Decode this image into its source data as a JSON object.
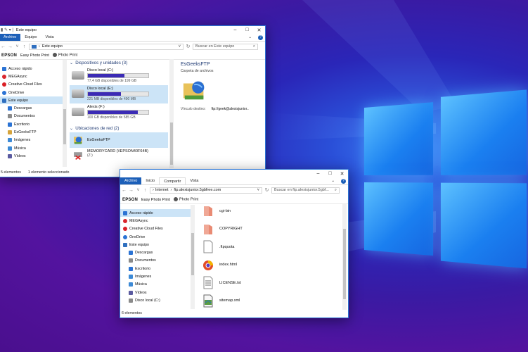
{
  "colors": {
    "accent": "#1c5fb8",
    "selection": "#cce4f7",
    "bar_fill": "#3b2bb5"
  },
  "back": {
    "title": "Este equipo",
    "tabs": [
      "Archivo",
      "Equipo",
      "Vista"
    ],
    "address": "Este equipo",
    "search_placeholder": "Buscar en Este equipo",
    "bookmarks": {
      "brand": "EPSON",
      "item1": "Easy Photo Print",
      "item2": "Photo Print"
    },
    "nav": [
      {
        "label": "Acceso rápido",
        "icon": "star-icon"
      },
      {
        "label": "MEGAsync",
        "icon": "mega-icon"
      },
      {
        "label": "Creative Cloud Files",
        "icon": "creative-cloud-icon"
      },
      {
        "label": "OneDrive",
        "icon": "cloud-icon"
      },
      {
        "label": "Este equipo",
        "icon": "computer-icon"
      },
      {
        "label": "Descargas",
        "icon": "download-icon"
      },
      {
        "label": "Documentos",
        "icon": "document-icon"
      },
      {
        "label": "Escritorio",
        "icon": "desktop-icon"
      },
      {
        "label": "EsGeeksFTP",
        "icon": "network-folder-icon"
      },
      {
        "label": "Imágenes",
        "icon": "image-icon"
      },
      {
        "label": "Música",
        "icon": "music-icon"
      },
      {
        "label": "Vídeos",
        "icon": "video-icon"
      }
    ],
    "group_devices": "Dispositivos y unidades (3)",
    "drives": [
      {
        "name": "Disco local (C:)",
        "free": "77,4 GB disponibles de 199 GB",
        "used_fraction": 0.61
      },
      {
        "name": "Disco local (E:)",
        "free": "221 MB disponibles de 490 MB",
        "used_fraction": 0.55
      },
      {
        "name": "Alexis (F:)",
        "free": "100 GB disponibles de 585 GB",
        "used_fraction": 0.83
      }
    ],
    "group_network": "Ubicaciones de red (2)",
    "network": [
      {
        "name": "EsGeeksFTP"
      },
      {
        "name": "MEMORYCARD (\\\\EPSON40F64B)",
        "sub": "(Z:)"
      }
    ],
    "detail": {
      "title": "EsGeeksFTP",
      "type": "Carpeta de archivos",
      "field_label": "Vínculo destino:",
      "field_value": "ftp://geek@alexisjunior.."
    },
    "status": {
      "count": "5 elementos",
      "selected": "1 elemento seleccionado"
    }
  },
  "front": {
    "tabs": [
      "Archivo",
      "Inicio",
      "Compartir",
      "Vista"
    ],
    "breadcrumb": [
      "Internet",
      "ftp.alexisjunior.5gbfree.com"
    ],
    "search_placeholder": "Buscar en ftp.alexisjunior.5gbf...",
    "bookmarks": {
      "brand": "EPSON",
      "item1": "Easy Photo Print",
      "item2": "Photo Print"
    },
    "nav": [
      {
        "label": "Acceso rápido",
        "icon": "star-icon"
      },
      {
        "label": "MEGAsync",
        "icon": "mega-icon"
      },
      {
        "label": "Creative Cloud Files",
        "icon": "creative-cloud-icon"
      },
      {
        "label": "OneDrive",
        "icon": "cloud-icon"
      },
      {
        "label": "Este equipo",
        "icon": "computer-icon"
      },
      {
        "label": "Descargas",
        "icon": "download-icon"
      },
      {
        "label": "Documentos",
        "icon": "document-icon"
      },
      {
        "label": "Escritorio",
        "icon": "desktop-icon"
      },
      {
        "label": "Imágenes",
        "icon": "image-icon"
      },
      {
        "label": "Música",
        "icon": "music-icon"
      },
      {
        "label": "Vídeos",
        "icon": "video-icon"
      },
      {
        "label": "Disco local (C:)",
        "icon": "drive-icon"
      }
    ],
    "files": [
      {
        "name": "cgi-bin",
        "icon": "folder-icon"
      },
      {
        "name": "COPYRIGHT",
        "icon": "folder-icon"
      },
      {
        "name": ".ftpquota",
        "icon": "file-icon"
      },
      {
        "name": "index.html",
        "icon": "browser-icon"
      },
      {
        "name": "LICENSE.txt",
        "icon": "text-file-icon"
      },
      {
        "name": "sitemap.xml",
        "icon": "xml-file-icon"
      }
    ],
    "status": {
      "count": "6 elementos"
    }
  }
}
